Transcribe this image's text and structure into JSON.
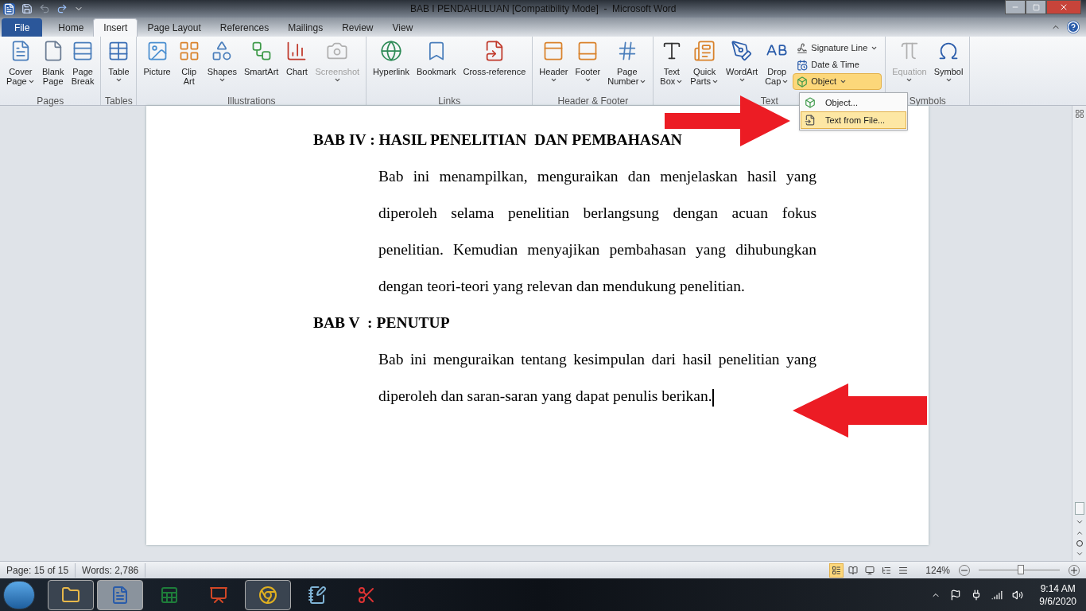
{
  "window": {
    "title": "BAB I PENDAHULUAN [Compatibility Mode]  -  Microsoft Word"
  },
  "tabs": [
    {
      "label": "File",
      "kind": "file",
      "selected": false
    },
    {
      "label": "Home",
      "kind": "tab",
      "selected": false
    },
    {
      "label": "Insert",
      "kind": "tab",
      "selected": true
    },
    {
      "label": "Page Layout",
      "kind": "tab",
      "selected": false
    },
    {
      "label": "References",
      "kind": "tab",
      "selected": false
    },
    {
      "label": "Mailings",
      "kind": "tab",
      "selected": false
    },
    {
      "label": "Review",
      "kind": "tab",
      "selected": false
    },
    {
      "label": "View",
      "kind": "tab",
      "selected": false
    }
  ],
  "ribbon": [
    {
      "label": "Pages",
      "items": [
        {
          "kind": "large",
          "lines": [
            "Cover",
            "Page"
          ],
          "dropdown": true,
          "disabled": false
        },
        {
          "kind": "large",
          "lines": [
            "Blank",
            "Page"
          ],
          "dropdown": false,
          "disabled": false
        },
        {
          "kind": "large",
          "lines": [
            "Page",
            "Break"
          ],
          "dropdown": false,
          "disabled": false
        }
      ]
    },
    {
      "label": "Tables",
      "items": [
        {
          "kind": "large",
          "lines": [
            "Table"
          ],
          "dropdown": true,
          "disabled": false
        }
      ]
    },
    {
      "label": "Illustrations",
      "items": [
        {
          "kind": "large",
          "lines": [
            "Picture"
          ],
          "dropdown": false,
          "disabled": false
        },
        {
          "kind": "large",
          "lines": [
            "Clip",
            "Art"
          ],
          "dropdown": false,
          "disabled": false
        },
        {
          "kind": "large",
          "lines": [
            "Shapes"
          ],
          "dropdown": true,
          "disabled": false
        },
        {
          "kind": "large",
          "lines": [
            "SmartArt"
          ],
          "dropdown": false,
          "disabled": false
        },
        {
          "kind": "large",
          "lines": [
            "Chart"
          ],
          "dropdown": false,
          "disabled": false
        },
        {
          "kind": "large",
          "lines": [
            "Screenshot"
          ],
          "dropdown": true,
          "disabled": true
        }
      ]
    },
    {
      "label": "Links",
      "items": [
        {
          "kind": "large",
          "lines": [
            "Hyperlink"
          ],
          "dropdown": false,
          "disabled": false
        },
        {
          "kind": "large",
          "lines": [
            "Bookmark"
          ],
          "dropdown": false,
          "disabled": false
        },
        {
          "kind": "large",
          "lines": [
            "Cross-reference"
          ],
          "dropdown": false,
          "disabled": false
        }
      ]
    },
    {
      "label": "Header & Footer",
      "items": [
        {
          "kind": "large",
          "lines": [
            "Header"
          ],
          "dropdown": true,
          "disabled": false
        },
        {
          "kind": "large",
          "lines": [
            "Footer"
          ],
          "dropdown": true,
          "disabled": false
        },
        {
          "kind": "large",
          "lines": [
            "Page",
            "Number"
          ],
          "dropdown": true,
          "disabled": false
        }
      ]
    },
    {
      "label": "Text",
      "items": [
        {
          "kind": "large",
          "lines": [
            "Text",
            "Box"
          ],
          "dropdown": true,
          "disabled": false
        },
        {
          "kind": "large",
          "lines": [
            "Quick",
            "Parts"
          ],
          "dropdown": true,
          "disabled": false
        },
        {
          "kind": "large",
          "lines": [
            "WordArt"
          ],
          "dropdown": true,
          "disabled": false
        },
        {
          "kind": "large",
          "lines": [
            "Drop",
            "Cap"
          ],
          "dropdown": true,
          "disabled": false
        },
        {
          "kind": "small",
          "lines": [
            "Signature Line"
          ],
          "dropdown": true,
          "disabled": false,
          "pressed": false
        },
        {
          "kind": "small",
          "lines": [
            "Date & Time"
          ],
          "dropdown": false,
          "disabled": false,
          "pressed": false
        },
        {
          "kind": "small",
          "lines": [
            "Object"
          ],
          "dropdown": true,
          "disabled": false,
          "pressed": true
        }
      ]
    },
    {
      "label": "Symbols",
      "items": [
        {
          "kind": "large",
          "lines": [
            "Equation"
          ],
          "dropdown": true,
          "disabled": true
        },
        {
          "kind": "large",
          "lines": [
            "Symbol"
          ],
          "dropdown": true,
          "disabled": false
        }
      ]
    }
  ],
  "object_menu": [
    {
      "label": "Object...",
      "selected": false
    },
    {
      "label": "Text from File...",
      "selected": true
    }
  ],
  "document": [
    {
      "kind": "heading",
      "text": "BAB IV : HASIL PENELITIAN  DAN PEMBAHASAN"
    },
    {
      "kind": "paragraph",
      "text": "Bab ini menampilkan, menguraikan dan menjelaskan hasil yang diperoleh selama penelitian berlangsung dengan acuan fokus penelitian. Kemudian menyajikan pembahasan yang dihubungkan dengan teori-teori yang relevan dan mendukung penelitian."
    },
    {
      "kind": "heading",
      "text": "BAB V  : PENUTUP"
    },
    {
      "kind": "paragraph",
      "text": "Bab ini menguraikan tentang kesimpulan dari hasil penelitian yang diperoleh dan saran-saran yang dapat penulis berikan.",
      "cursor": true
    }
  ],
  "annotation_arrows": [
    {
      "kind": "right"
    },
    {
      "kind": "left"
    }
  ],
  "status_bar": {
    "page": "Page: 15 of 15",
    "words": "Words: 2,786",
    "views": [
      {
        "selected": true
      },
      {
        "selected": false
      },
      {
        "selected": false
      },
      {
        "selected": false
      },
      {
        "selected": false
      }
    ],
    "zoom": "124%",
    "zoom_level": {
      "level": 0.52
    }
  },
  "taskbar": {
    "apps": [
      {
        "open": true,
        "selected": false
      },
      {
        "open": true,
        "selected": true
      },
      {
        "open": false,
        "selected": false
      },
      {
        "open": false,
        "selected": false
      },
      {
        "open": true,
        "selected": false
      },
      {
        "open": false,
        "selected": false
      },
      {
        "open": false,
        "selected": false
      }
    ],
    "time": "9:14 AM",
    "date": "9/6/2020"
  }
}
